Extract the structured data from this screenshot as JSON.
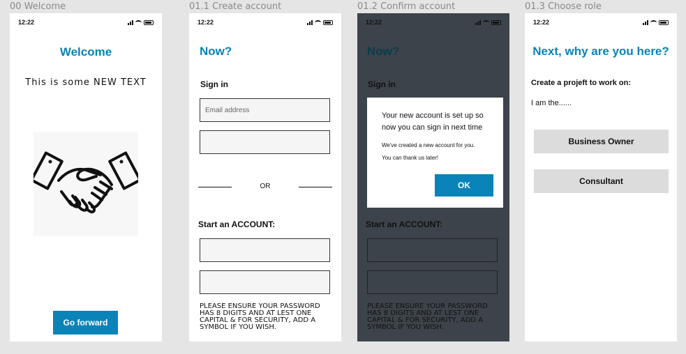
{
  "frames": [
    {
      "label": "00 Welcome"
    },
    {
      "label": "01.1 Create account"
    },
    {
      "label": "01.2 Confirm account"
    },
    {
      "label": "01.3 Choose role"
    }
  ],
  "status_time": "12:22",
  "welcome": {
    "title": "Welcome",
    "text": "This is some NEW TEXT",
    "illustration": "handshake-icon",
    "button": "Go forward"
  },
  "create_account": {
    "title": "Now?",
    "signin_label": "Sign in",
    "email_placeholder": "Email address",
    "or_label": "OR",
    "start_label": "Start an ACCOUNT:",
    "password_note": "PLEASE ENSURE YOUR PASSWORD HAS 8 DIGITS AND AT LEST ONE CAPITAL & FOR SECURITY, ADD A SYMBOL IF YOU WISH."
  },
  "confirm_account": {
    "title": "Now?",
    "signin_label": "Sign in",
    "start_label": "Start an ACCOUNT:",
    "password_note": "PLEASE ENSURE YOUR PASSWORD HAS 8 DIGITS AND AT LEST ONE CAPITAL & FOR SECURITY, ADD A SYMBOL IF YOU WISH.",
    "modal": {
      "heading": "Your new account is set up so now you can sign in next time",
      "body_line1": "We've created a new account for you.",
      "body_line2": "You can thank us later!",
      "ok": "OK"
    }
  },
  "choose_role": {
    "title": "Next, why are you here?",
    "prompt": "Create a projeft to work on:",
    "iam": "I am the......",
    "option1": "Business Owner",
    "option2": "Consultant"
  },
  "colors": {
    "accent": "#0a83b8",
    "dark_overlay": "#3d434a",
    "button_grey": "#dcdcdc"
  }
}
